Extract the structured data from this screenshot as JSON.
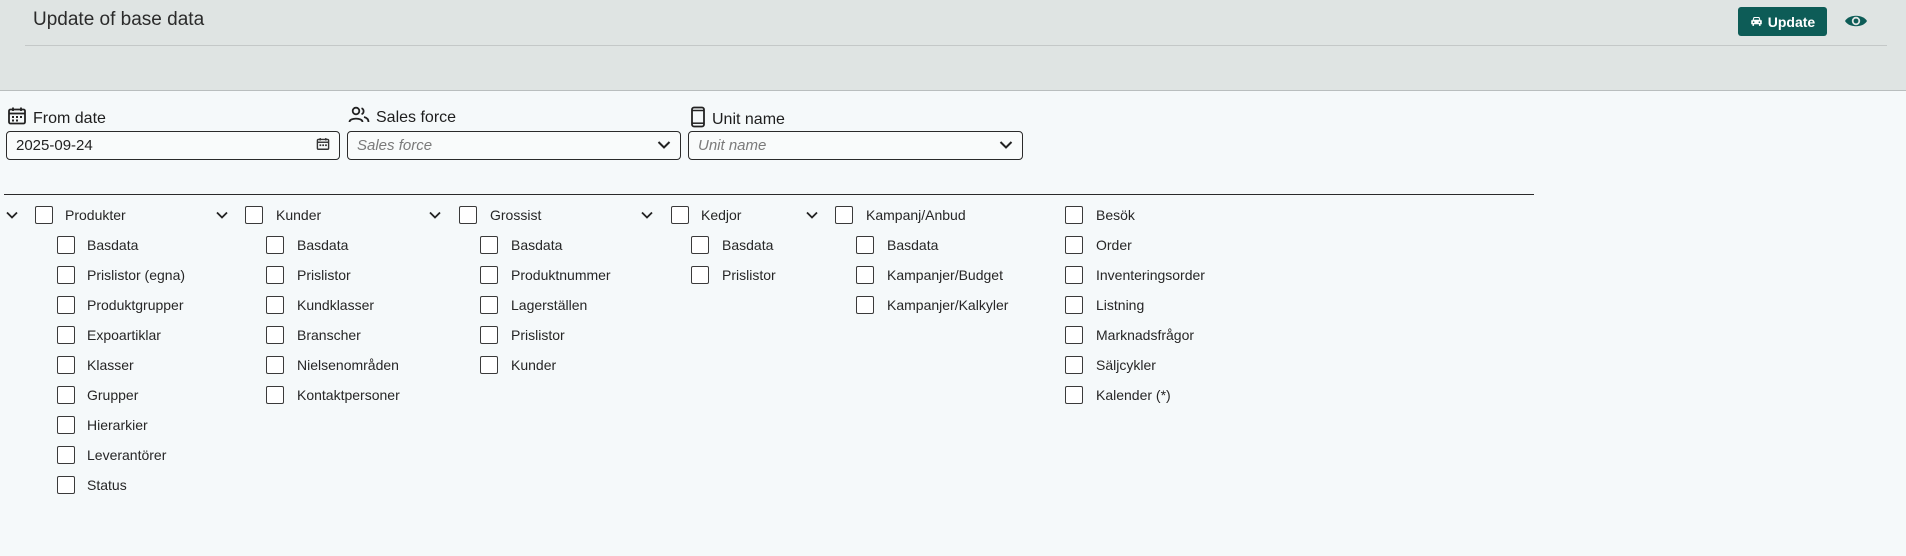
{
  "header": {
    "title": "Update of base data",
    "update_label": "Update"
  },
  "fields": {
    "from_date": {
      "label": "From date",
      "value": "2025-09-24"
    },
    "sales_force": {
      "label": "Sales force",
      "placeholder": "Sales force"
    },
    "unit_name": {
      "label": "Unit name",
      "placeholder": "Unit name"
    }
  },
  "groups": [
    {
      "label": "Produkter",
      "items": [
        "Basdata",
        "Prislistor (egna)",
        "Produktgrupper",
        "Expoartiklar",
        "Klasser",
        "Grupper",
        "Hierarkier",
        "Leverantörer",
        "Status"
      ]
    },
    {
      "label": "Kunder",
      "items": [
        "Basdata",
        "Prislistor",
        "Kundklasser",
        "Branscher",
        "Nielsenområden",
        "Kontaktpersoner"
      ]
    },
    {
      "label": "Grossist",
      "items": [
        "Basdata",
        "Produktnummer",
        "Lagerställen",
        "Prislistor",
        "Kunder"
      ]
    },
    {
      "label": "Kedjor",
      "items": [
        "Basdata",
        "Prislistor"
      ]
    },
    {
      "label": "Kampanj/Anbud",
      "items": [
        "Basdata",
        "Kampanjer/Budget",
        "Kampanjer/Kalkyler"
      ]
    },
    {
      "label": "Besök",
      "items": [
        "Order",
        "Inventeringsorder",
        "Listning",
        "Marknadsfrågor",
        "Säljcykler",
        "Kalender (*)"
      ]
    }
  ],
  "colors": {
    "accent": "#0d5c57",
    "header_bg": "#dfe4e3",
    "page_bg": "#f5f9fa"
  }
}
